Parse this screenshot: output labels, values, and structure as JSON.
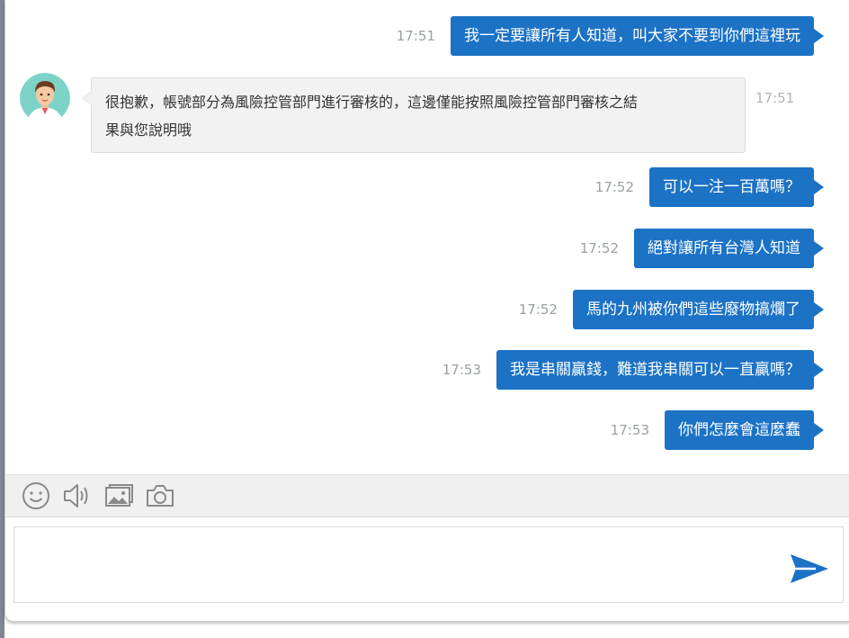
{
  "messages_out": [
    {
      "time": "17:51",
      "text": "我一定要讓所有人知道，叫大家不要到你們這裡玩"
    },
    {
      "time": "17:52",
      "text": "可以一注一百萬嗎？"
    },
    {
      "time": "17:52",
      "text": "絕對讓所有台灣人知道"
    },
    {
      "time": "17:52",
      "text": "馬的九州被你們這些廢物搞爛了"
    },
    {
      "time": "17:53",
      "text": "我是串關贏錢，難道我串關可以一直贏嗎？"
    },
    {
      "time": "17:53",
      "text": "你們怎麼會這麼蠢"
    }
  ],
  "message_in": {
    "time": "17:51",
    "line1": "很抱歉，帳號部分為風險控管部門進行審核的，這邊僅能按照風險控管部門審核之結",
    "line2": "果與您說明哦"
  },
  "toolbar": {
    "icons": [
      "emoji-icon",
      "audio-icon",
      "image-icon",
      "camera-icon"
    ]
  },
  "composer": {
    "value": "",
    "placeholder": ""
  },
  "colors": {
    "outgoing_bubble": "#1c72c5",
    "incoming_bubble": "#f2f2f2",
    "send_icon": "#1c72c5"
  }
}
